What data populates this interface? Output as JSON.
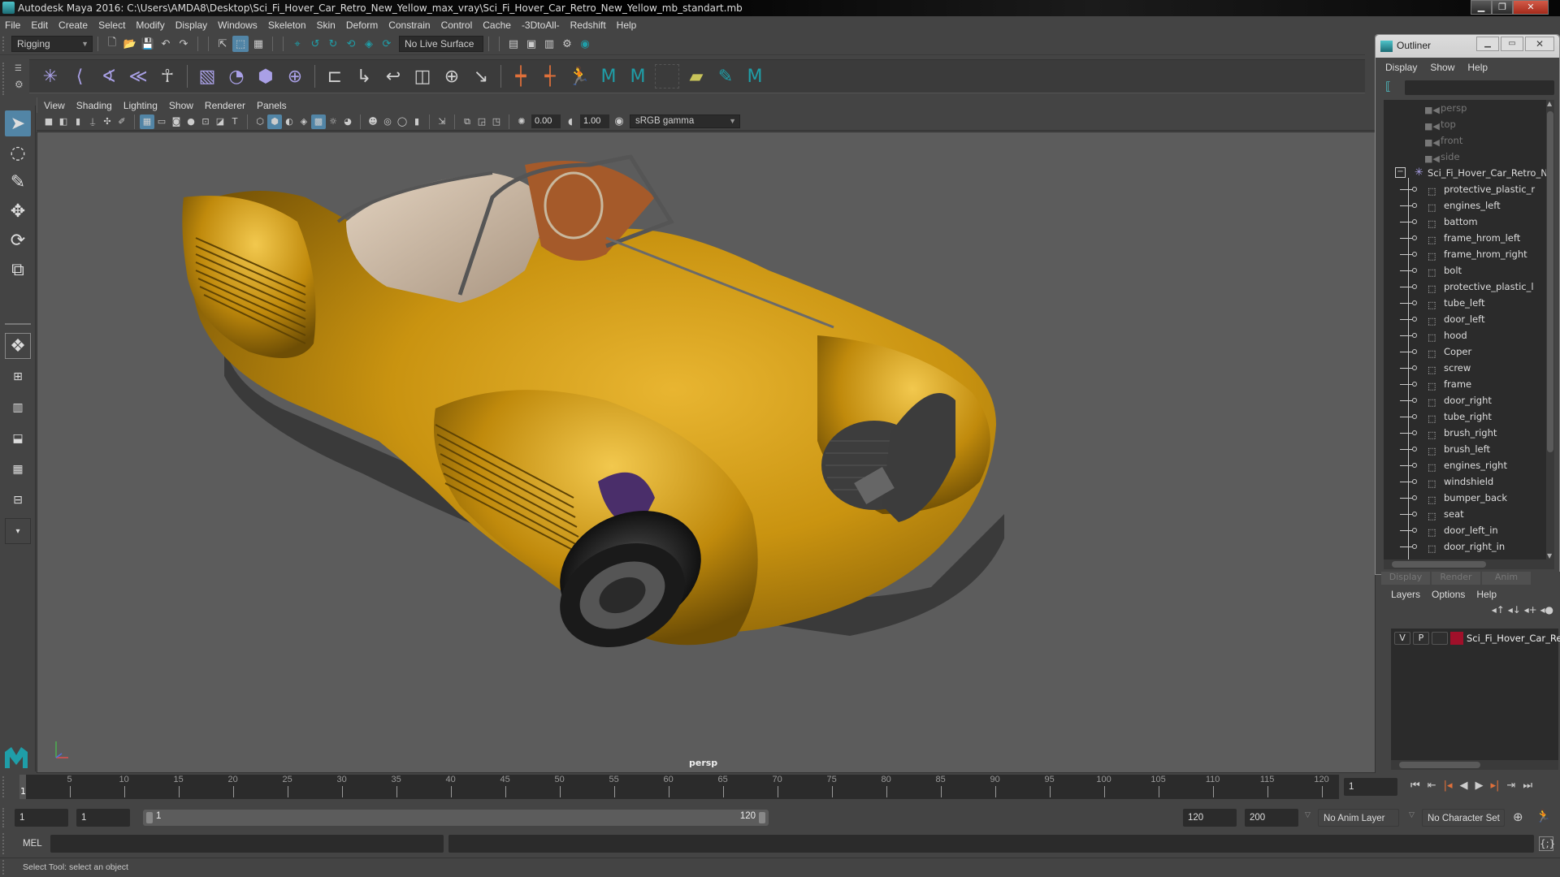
{
  "window": {
    "title": "Autodesk Maya 2016: C:\\Users\\AMDA8\\Desktop\\Sci_Fi_Hover_Car_Retro_New_Yellow_max_vray\\Sci_Fi_Hover_Car_Retro_New_Yellow_mb_standart.mb",
    "controls": [
      "minimize",
      "maximize",
      "close"
    ]
  },
  "menubar": [
    "File",
    "Edit",
    "Create",
    "Select",
    "Modify",
    "Display",
    "Windows",
    "Skeleton",
    "Skin",
    "Deform",
    "Constrain",
    "Control",
    "Cache",
    "-3DtoAll-",
    "Redshift",
    "Help"
  ],
  "status_line": {
    "menu_set": "Rigging",
    "live_surface": "No Live Surface"
  },
  "shelf": {
    "icons": [
      "joint-tool-icon",
      "ik-handle-icon",
      "ik-spline-icon",
      "ik-chain-icon",
      "humanik-icon",
      "bind-skin-icon",
      "smooth-bind-icon",
      "lattice-icon",
      "cluster-icon",
      "parent-constraint-icon",
      "point-constraint-icon",
      "orient-constraint-icon",
      "scale-constraint-icon",
      "aim-constraint-icon",
      "pole-vector-icon",
      "set-key-icon",
      "set-driven-key-icon",
      "character-icon",
      "maya-logo-icon",
      "maya-logo-icon",
      "empty-slot",
      "layer-icon",
      "paint-weights-icon",
      "maya-logo-icon"
    ]
  },
  "panel": {
    "menu": [
      "View",
      "Shading",
      "Lighting",
      "Show",
      "Renderer",
      "Panels"
    ],
    "exposure": "0.00",
    "gamma": "1.00",
    "color_space": "sRGB gamma",
    "camera": "persp"
  },
  "outliner": {
    "title": "Outliner",
    "menu": [
      "Display",
      "Show",
      "Help"
    ],
    "cameras": [
      "persp",
      "top",
      "front",
      "side"
    ],
    "group": "Sci_Fi_Hover_Car_Retro_Ne",
    "children": [
      "protective_plastic_r",
      "engines_left",
      "battom",
      "frame_hrom_left",
      "frame_hrom_right",
      "bolt",
      "protective_plastic_l",
      "tube_left",
      "door_left",
      "hood",
      "Coper",
      "screw",
      "frame",
      "door_right",
      "tube_right",
      "brush_right",
      "brush_left",
      "engines_right",
      "windshield",
      "bumper_back",
      "seat",
      "door_left_in",
      "door_right_in"
    ]
  },
  "layer_editor": {
    "tabs": [
      "Display",
      "Render",
      "Anim"
    ],
    "menu": [
      "Layers",
      "Options",
      "Help"
    ],
    "layers": [
      {
        "v": "V",
        "p": "P",
        "color": "#a0102a",
        "name": "Sci_Fi_Hover_Car_Retro"
      }
    ]
  },
  "timeline": {
    "current_frame": "1",
    "ticks": [
      "5",
      "10",
      "15",
      "20",
      "25",
      "30",
      "35",
      "40",
      "45",
      "50",
      "55",
      "60",
      "65",
      "70",
      "75",
      "80",
      "85",
      "90",
      "95",
      "100",
      "105",
      "110",
      "115",
      "120"
    ],
    "current_field": "1",
    "start": "1",
    "playback_start": "1",
    "range_start": "1",
    "range_end": "120",
    "playback_end": "120",
    "end": "200",
    "anim_layer": "No Anim Layer",
    "character_set": "No Character Set"
  },
  "command_line": {
    "lang": "MEL",
    "input": "",
    "output": ""
  },
  "help_line": "Select Tool: select an object"
}
